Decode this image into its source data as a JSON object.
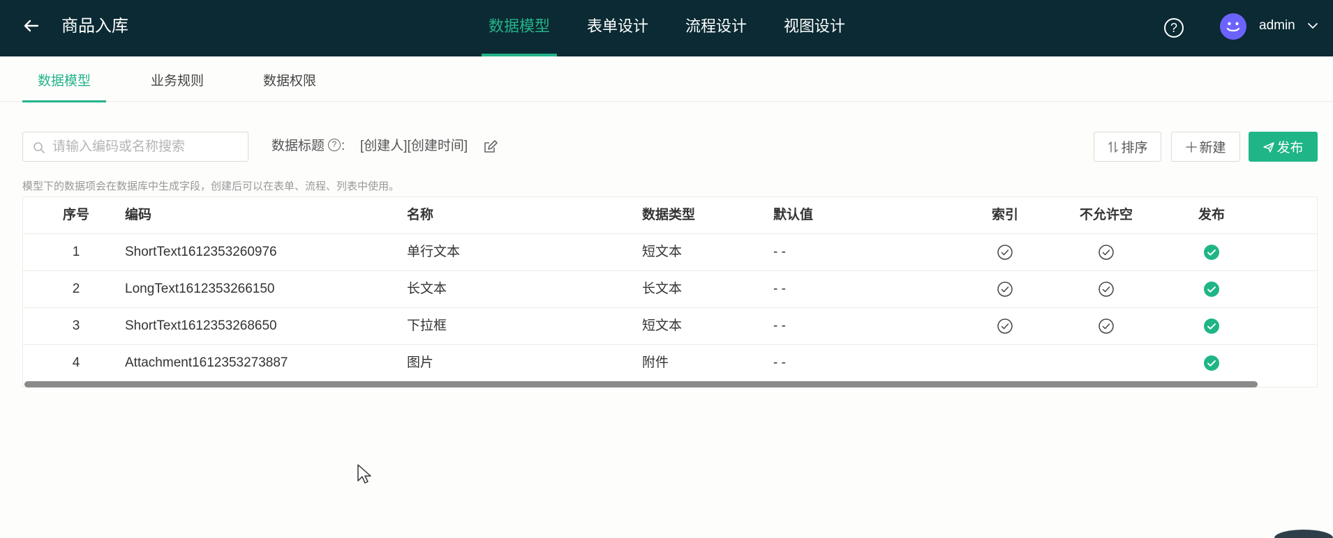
{
  "header": {
    "title": "商品入库",
    "nav": [
      {
        "label": "数据模型",
        "active": true
      },
      {
        "label": "表单设计",
        "active": false
      },
      {
        "label": "流程设计",
        "active": false
      },
      {
        "label": "视图设计",
        "active": false
      }
    ],
    "help_glyph": "?",
    "user": "admin"
  },
  "subtabs": [
    {
      "label": "数据模型",
      "active": true
    },
    {
      "label": "业务规则",
      "active": false
    },
    {
      "label": "数据权限",
      "active": false
    }
  ],
  "toolbar": {
    "search_placeholder": "请输入编码或名称搜索",
    "data_title_label": "数据标题",
    "data_title_help": "?",
    "data_title_colon": ":",
    "data_title_value": "[创建人][创建时间]",
    "sort_label": "排序",
    "new_label": "新建",
    "publish_label": "发布"
  },
  "hint": "模型下的数据项会在数据库中生成字段，创建后可以在表单、流程、列表中使用。",
  "table": {
    "columns": [
      "序号",
      "编码",
      "名称",
      "数据类型",
      "默认值",
      "索引",
      "不允许空",
      "发布"
    ],
    "rows": [
      {
        "no": "1",
        "code": "ShortText1612353260976",
        "name": "单行文本",
        "type": "短文本",
        "default": "- -",
        "index": true,
        "not_null": true,
        "published": true
      },
      {
        "no": "2",
        "code": "LongText1612353266150",
        "name": "长文本",
        "type": "长文本",
        "default": "- -",
        "index": true,
        "not_null": true,
        "published": true
      },
      {
        "no": "3",
        "code": "ShortText1612353268650",
        "name": "下拉框",
        "type": "短文本",
        "default": "- -",
        "index": true,
        "not_null": true,
        "published": true
      },
      {
        "no": "4",
        "code": "Attachment1612353273887",
        "name": "图片",
        "type": "附件",
        "default": "- -",
        "index": false,
        "not_null": false,
        "published": true
      }
    ]
  },
  "colors": {
    "header_bg": "#0b2a33",
    "accent": "#24b38a",
    "publish_button": "#1fb587"
  }
}
